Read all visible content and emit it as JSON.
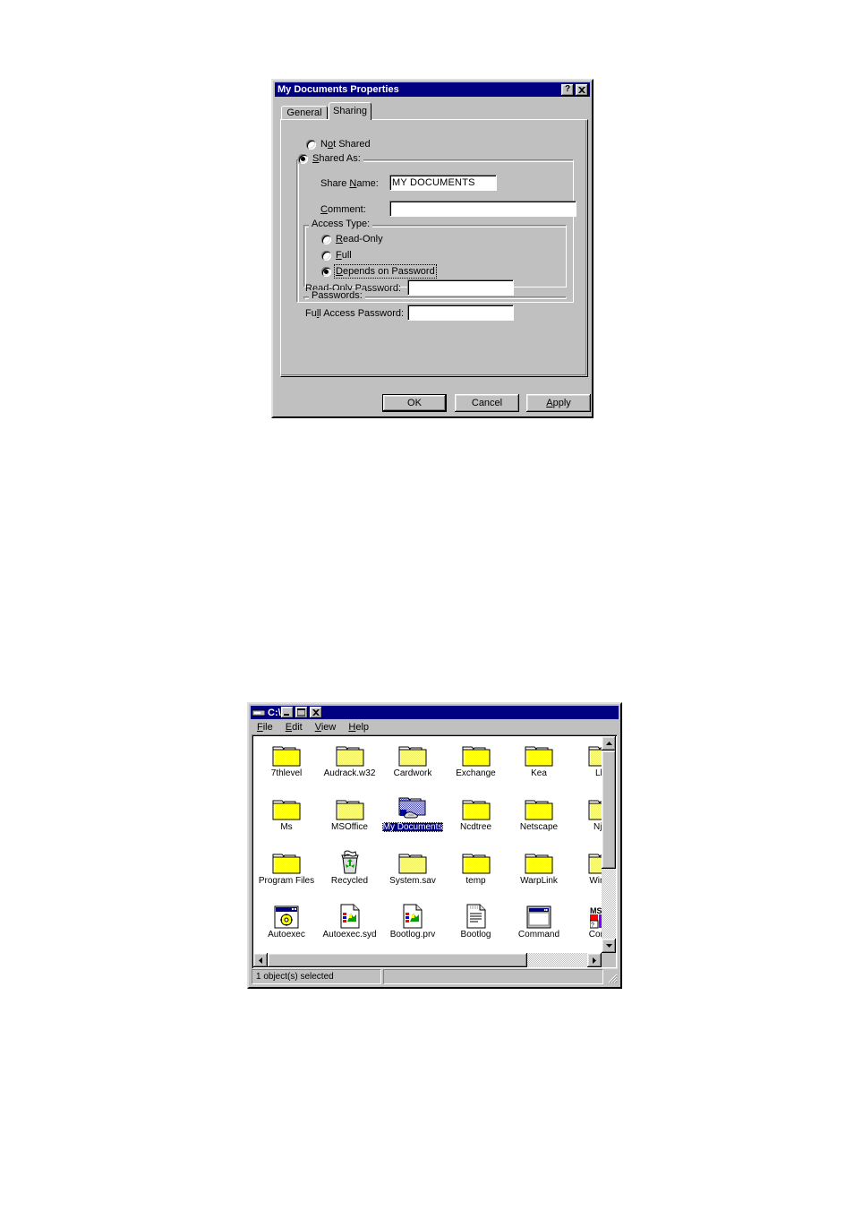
{
  "dialog": {
    "title": "My Documents Properties",
    "titlebar_buttons": [
      {
        "name": "help-button",
        "glyph": "?"
      },
      {
        "name": "close-button",
        "glyph": "✕"
      }
    ],
    "tabs": [
      {
        "label": "General",
        "active": false
      },
      {
        "label": "Sharing",
        "active": true
      }
    ],
    "share_mode": {
      "not_shared_label": "Not Shared",
      "not_shared_selected": false,
      "shared_as_label": "Shared As:",
      "shared_as_selected": true
    },
    "share_name_label": "Share Name:",
    "share_name_value": "MY DOCUMENTS",
    "comment_label": "Comment:",
    "comment_value": "",
    "access_type": {
      "group_label": "Access Type:",
      "options": [
        {
          "label": "Read-Only",
          "selected": false,
          "focused": false
        },
        {
          "label": "Full",
          "selected": false,
          "focused": false
        },
        {
          "label": "Depends on Password",
          "selected": true,
          "focused": true
        }
      ]
    },
    "passwords": {
      "group_label": "Passwords:",
      "read_only_label": "Read-Only Password:",
      "read_only_value": "",
      "full_access_label": "Full Access Password:",
      "full_access_value": ""
    },
    "buttons": [
      {
        "label": "OK",
        "default": true
      },
      {
        "label": "Cancel",
        "default": false
      },
      {
        "label": "Apply",
        "default": false
      }
    ]
  },
  "explorer": {
    "title": "C:\\",
    "titlebar_buttons": [
      {
        "name": "minimize-button"
      },
      {
        "name": "maximize-button"
      },
      {
        "name": "close-button"
      }
    ],
    "menu": [
      "File",
      "Edit",
      "View",
      "Help"
    ],
    "items": [
      {
        "label": "7thlevel",
        "type": "folder",
        "selected": false
      },
      {
        "label": "Audrack.w32",
        "type": "folder",
        "selected": false
      },
      {
        "label": "Cardwork",
        "type": "folder",
        "selected": false
      },
      {
        "label": "Exchange",
        "type": "folder",
        "selected": false
      },
      {
        "label": "Kea",
        "type": "folder",
        "selected": false
      },
      {
        "label": "Llw",
        "type": "folder",
        "selected": false
      },
      {
        "label": "Ms",
        "type": "folder",
        "selected": false
      },
      {
        "label": "MSOffice",
        "type": "folder",
        "selected": false
      },
      {
        "label": "My Documents",
        "type": "shared-folder",
        "selected": true
      },
      {
        "label": "Ncdtree",
        "type": "folder",
        "selected": false
      },
      {
        "label": "Netscape",
        "type": "folder",
        "selected": false
      },
      {
        "label": "Njwi",
        "type": "folder",
        "selected": false
      },
      {
        "label": "Program Files",
        "type": "folder",
        "selected": false
      },
      {
        "label": "Recycled",
        "type": "recycle-bin",
        "selected": false
      },
      {
        "label": "System.sav",
        "type": "folder",
        "selected": false
      },
      {
        "label": "temp",
        "type": "folder",
        "selected": false
      },
      {
        "label": "WarpLink",
        "type": "folder",
        "selected": false
      },
      {
        "label": "Windo",
        "type": "folder",
        "selected": false
      },
      {
        "label": "Autoexec",
        "type": "batch-file",
        "selected": false
      },
      {
        "label": "Autoexec.syd",
        "type": "config-file",
        "selected": false
      },
      {
        "label": "Bootlog.prv",
        "type": "config-file",
        "selected": false
      },
      {
        "label": "Bootlog",
        "type": "text-file",
        "selected": false
      },
      {
        "label": "Command",
        "type": "dos-program",
        "selected": false
      },
      {
        "label": "Comm",
        "type": "ms-program",
        "selected": false
      }
    ],
    "status": "1 object(s) selected",
    "status_right": ""
  },
  "colors": {
    "titlebar": "#000080",
    "face": "#c0c0c0",
    "highlight": "#000080",
    "folder": "#ffff00",
    "window": "#ffffff"
  }
}
